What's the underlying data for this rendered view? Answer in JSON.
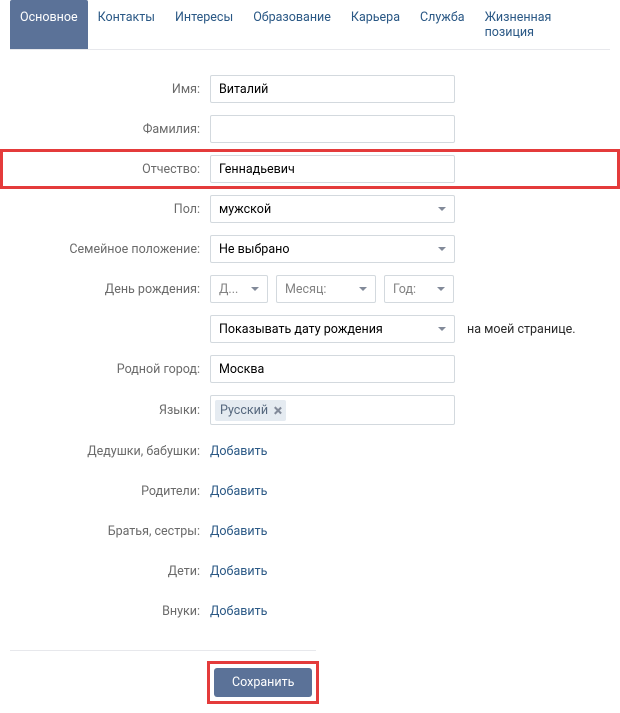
{
  "tabs": [
    {
      "label": "Основное",
      "active": true
    },
    {
      "label": "Контакты",
      "active": false
    },
    {
      "label": "Интересы",
      "active": false
    },
    {
      "label": "Образование",
      "active": false
    },
    {
      "label": "Карьера",
      "active": false
    },
    {
      "label": "Служба",
      "active": false
    },
    {
      "label": "Жизненная позиция",
      "active": false
    }
  ],
  "labels": {
    "first_name": "Имя:",
    "last_name": "Фамилия:",
    "patronymic": "Отчество:",
    "gender": "Пол:",
    "marital": "Семейное положение:",
    "birthday": "День рождения:",
    "hometown": "Родной город:",
    "languages": "Языки:",
    "grandparents": "Дедушки, бабушки:",
    "parents": "Родители:",
    "siblings": "Братья, сестры:",
    "children": "Дети:",
    "grandchildren": "Внуки:"
  },
  "values": {
    "first_name": "Виталий",
    "last_name": "",
    "patronymic": "Геннадьевич",
    "gender": "мужской",
    "marital": "Не выбрано",
    "bday_day": "Д...",
    "bday_month": "Месяц:",
    "bday_year": "Год:",
    "bday_visibility": "Показывать дату рождения",
    "bday_suffix": "на моей странице.",
    "hometown": "Москва",
    "language_token": "Русский"
  },
  "link_add": "Добавить",
  "save_label": "Сохранить"
}
